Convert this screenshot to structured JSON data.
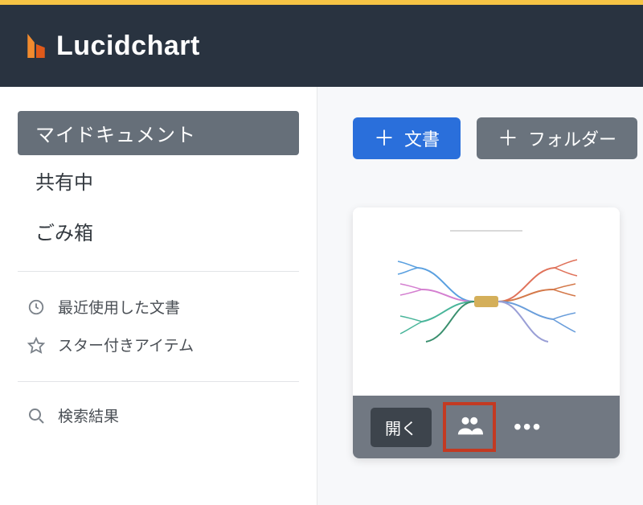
{
  "brand": {
    "name": "Lucidchart"
  },
  "sidebar": {
    "primary": [
      {
        "label": "マイドキュメント",
        "active": true
      },
      {
        "label": "共有中"
      },
      {
        "label": "ごみ箱"
      }
    ],
    "secondary": [
      {
        "label": "最近使用した文書",
        "icon": "clock-icon"
      },
      {
        "label": "スター付きアイテム",
        "icon": "star-icon"
      }
    ],
    "search": {
      "label": "検索結果",
      "icon": "search-icon"
    }
  },
  "actions": {
    "new_document": "文書",
    "new_folder": "フォルダー"
  },
  "document_card": {
    "open_label": "開く"
  }
}
